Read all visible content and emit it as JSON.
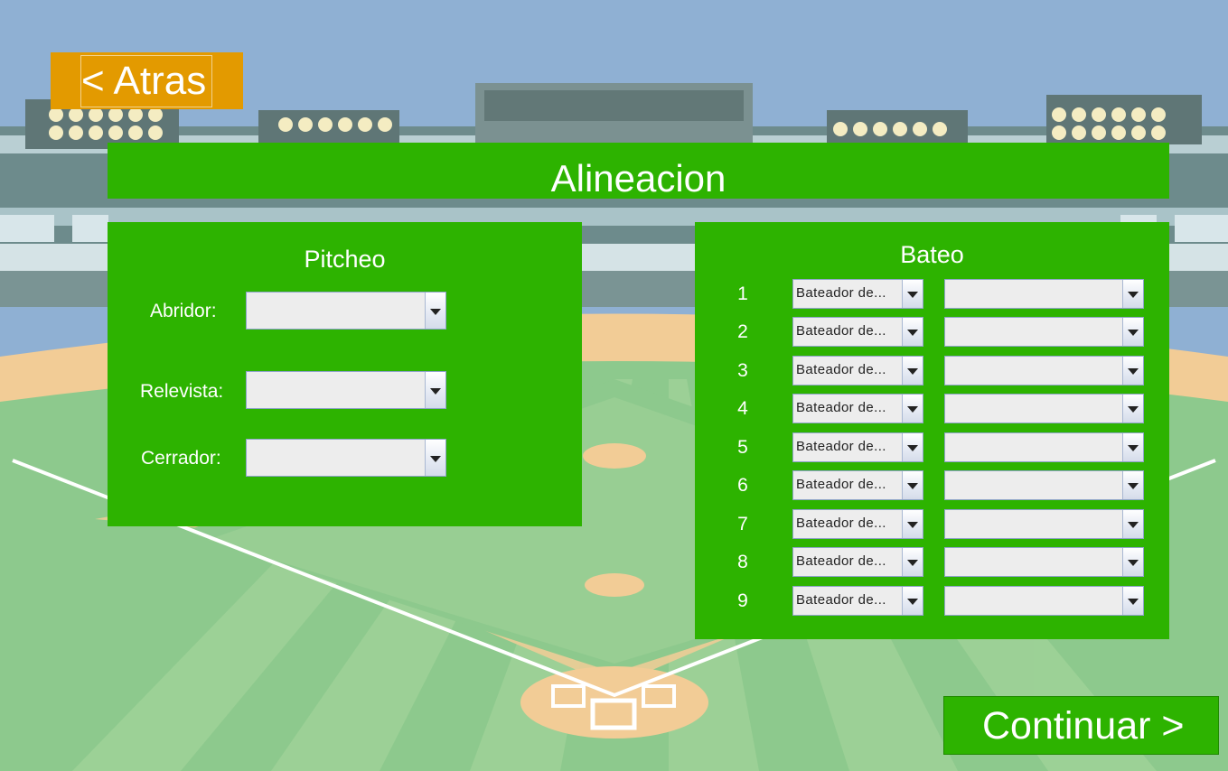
{
  "header": {
    "back_label": "< Atras",
    "title": "Alineacion"
  },
  "pitching": {
    "heading": "Pitcheo",
    "rows": [
      {
        "label": "Abridor:",
        "value": ""
      },
      {
        "label": "Relevista:",
        "value": ""
      },
      {
        "label": "Cerrador:",
        "value": ""
      }
    ]
  },
  "batting": {
    "heading": "Bateo",
    "rows": [
      {
        "number": "1",
        "role": "Bateador de...",
        "player": ""
      },
      {
        "number": "2",
        "role": "Bateador de...",
        "player": ""
      },
      {
        "number": "3",
        "role": "Bateador de...",
        "player": ""
      },
      {
        "number": "4",
        "role": "Bateador de...",
        "player": ""
      },
      {
        "number": "5",
        "role": "Bateador de...",
        "player": ""
      },
      {
        "number": "6",
        "role": "Bateador de...",
        "player": ""
      },
      {
        "number": "7",
        "role": "Bateador de...",
        "player": ""
      },
      {
        "number": "8",
        "role": "Bateador de...",
        "player": ""
      },
      {
        "number": "9",
        "role": "Bateador de...",
        "player": ""
      }
    ]
  },
  "footer": {
    "continue_label": "Continuar >"
  },
  "colors": {
    "panel_green": "#2db300",
    "back_orange": "#e39a00",
    "sky": "#8fb0d3",
    "field_green": "#8dc98d",
    "dirt": "#f2cc96"
  }
}
